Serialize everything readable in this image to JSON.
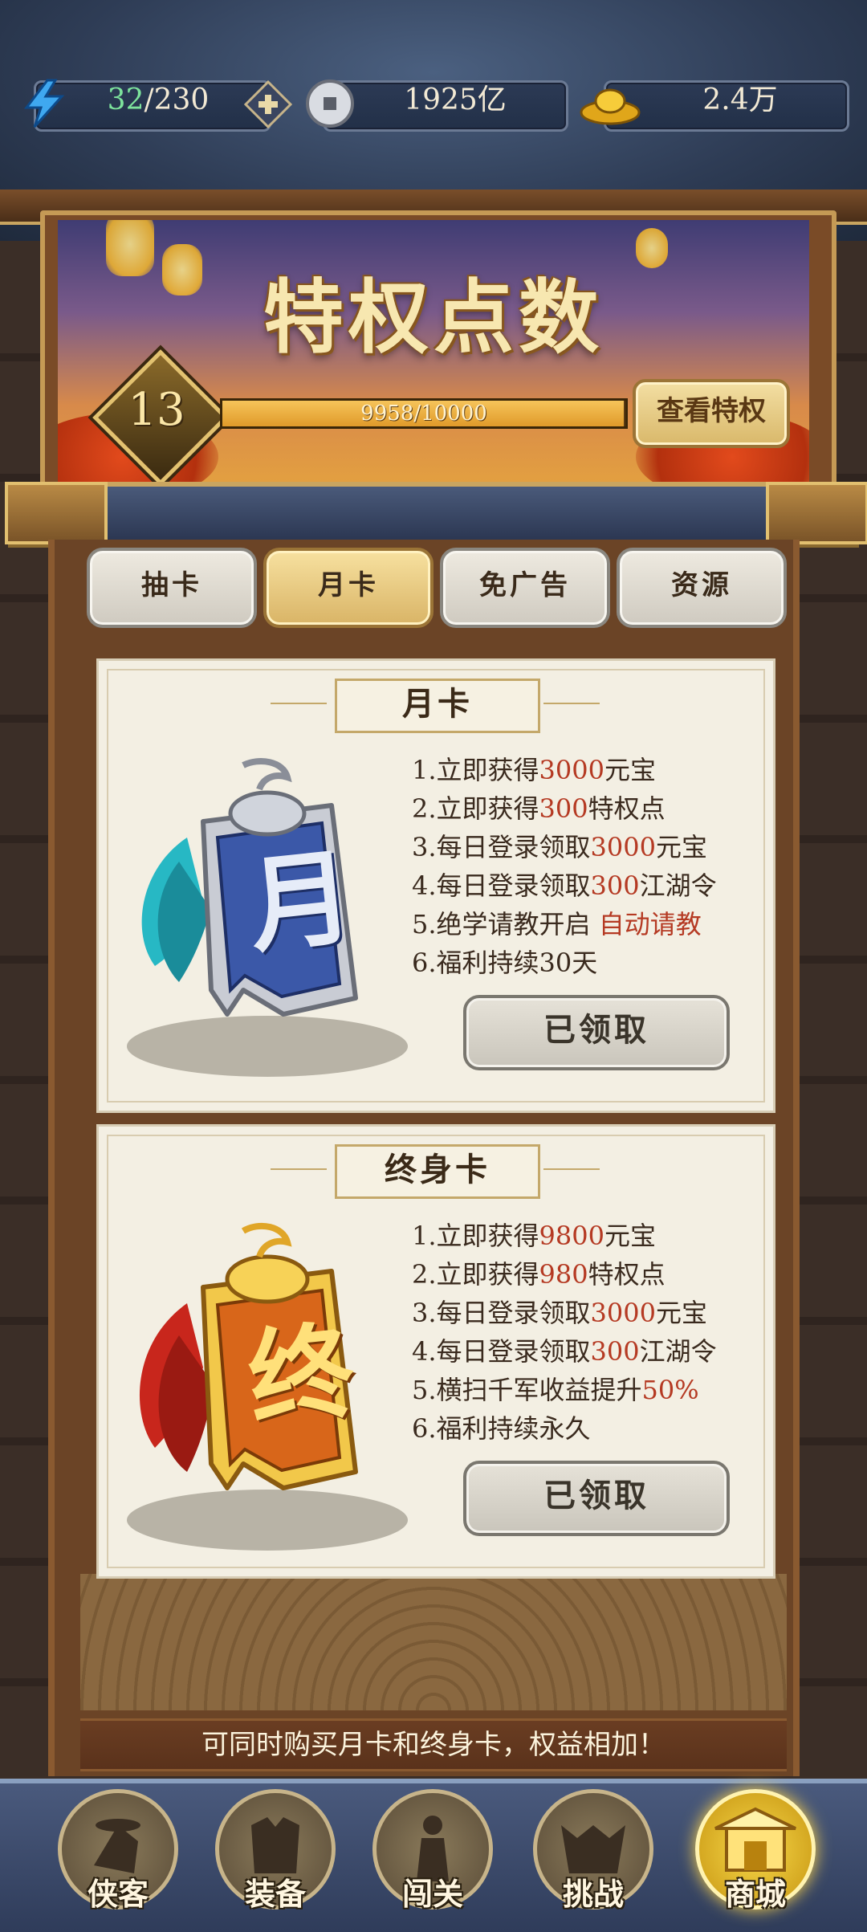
{
  "resources": {
    "energy_current": "32",
    "energy_max": "/230",
    "silver": "1925亿",
    "gold": "2.4万"
  },
  "banner": {
    "title": "特权点数",
    "level": "13",
    "progress_text": "9958/10000",
    "progress_fraction": 0.9958,
    "view_button": "查看特权"
  },
  "tabs": [
    {
      "label": "抽卡",
      "active": false
    },
    {
      "label": "月卡",
      "active": true
    },
    {
      "label": "免广告",
      "active": false
    },
    {
      "label": "资源",
      "active": false
    }
  ],
  "cards": [
    {
      "title": "月卡",
      "emblem_char": "月",
      "benefits": [
        {
          "pre": "1.立即获得",
          "hl": "3000",
          "post": "元宝"
        },
        {
          "pre": "2.立即获得",
          "hl": "300",
          "post": "特权点"
        },
        {
          "pre": "3.每日登录领取",
          "hl": "3000",
          "post": "元宝"
        },
        {
          "pre": "4.每日登录领取",
          "hl": "300",
          "post": "江湖令"
        },
        {
          "pre": "5.绝学请教开启 ",
          "hl": "自动请教",
          "post": ""
        },
        {
          "pre": "6.福利持续30天",
          "hl": "",
          "post": ""
        }
      ],
      "button": "已领取"
    },
    {
      "title": "终身卡",
      "emblem_char": "终",
      "benefits": [
        {
          "pre": "1.立即获得",
          "hl": "9800",
          "post": "元宝"
        },
        {
          "pre": "2.立即获得",
          "hl": "980",
          "post": "特权点"
        },
        {
          "pre": "3.每日登录领取",
          "hl": "3000",
          "post": "元宝"
        },
        {
          "pre": "4.每日登录领取",
          "hl": "300",
          "post": "江湖令"
        },
        {
          "pre": "5.横扫千军收益提升",
          "hl": "50%",
          "post": ""
        },
        {
          "pre": "6.福利持续永久",
          "hl": "",
          "post": ""
        }
      ],
      "button": "已领取"
    }
  ],
  "footer_note": "可同时购买月卡和终身卡，权益相加！",
  "nav": [
    {
      "label": "侠客",
      "icon": "swordsman-icon",
      "active": false
    },
    {
      "label": "装备",
      "icon": "armor-icon",
      "active": false
    },
    {
      "label": "闯关",
      "icon": "warrior-icon",
      "active": false
    },
    {
      "label": "挑战",
      "icon": "demon-mask-icon",
      "active": false
    },
    {
      "label": "商城",
      "icon": "shop-pavilion-icon",
      "active": true
    }
  ],
  "colors": {
    "highlight": "#b53a23",
    "energy_current": "#7de39c",
    "active_tab": "#d9b466"
  }
}
